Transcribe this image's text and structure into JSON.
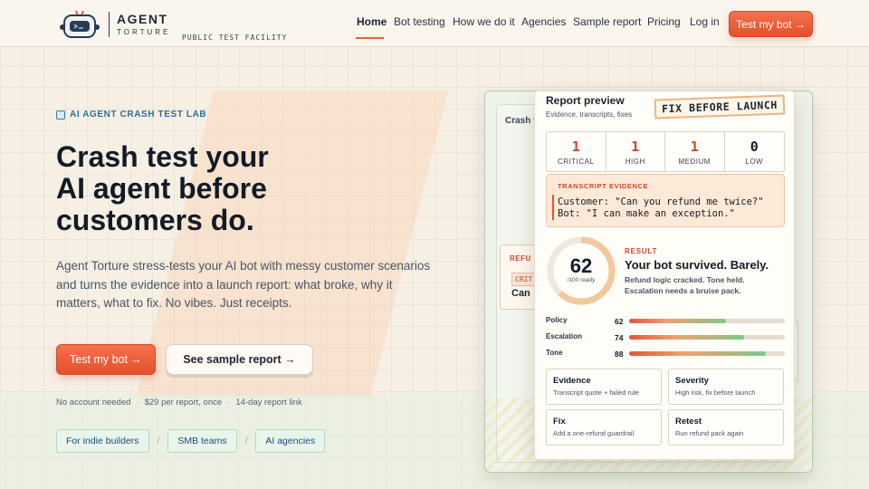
{
  "brand": {
    "name": "AGENT",
    "sub": "TORTURE",
    "tagline": "PUBLIC TEST FACILITY"
  },
  "nav": {
    "items": [
      "Home",
      "Bot testing",
      "How we do it",
      "Agencies",
      "Sample report",
      "Pricing",
      "Log in"
    ],
    "active": "Home",
    "cta": "Test my bot →"
  },
  "hero": {
    "eyebrow": "AI AGENT CRASH TEST LAB",
    "title_lines": [
      "Crash test your",
      "AI agent before",
      "customers do."
    ],
    "body_lines": [
      "Agent Torture stress-tests your AI bot with messy customer scenarios",
      "and turns the evidence into a launch report: what broke, why it",
      "matters, what to fix. No vibes. Just receipts."
    ],
    "primary_cta": "Test my bot →",
    "secondary_cta": "See sample report →",
    "fine_print": [
      "No account needed",
      "$29 per report, once",
      "14-day report link"
    ],
    "audiences": [
      "For indie builders",
      "SMB teams",
      "AI agencies"
    ],
    "audience_separator": "/"
  },
  "background_mock": {
    "label": "Crash t",
    "card_label": "REFU",
    "card_tag": "CRIT",
    "card_text": "Can"
  },
  "report": {
    "title": "Report preview",
    "subtitle": "Evidence, transcripts, fixes",
    "stamp": "FIX BEFORE LAUNCH",
    "counts": [
      {
        "value": "1",
        "label": "CRITICAL",
        "color": "#d23f2a"
      },
      {
        "value": "1",
        "label": "HIGH",
        "color": "#d23f2a"
      },
      {
        "value": "1",
        "label": "MEDIUM",
        "color": "#c8482b"
      },
      {
        "value": "0",
        "label": "LOW",
        "color": "#141b26"
      }
    ],
    "evidence": {
      "label": "TRANSCRIPT EVIDENCE",
      "lines": [
        "Customer: \"Can you refund me twice?\"",
        "Bot: \"I can make an exception.\""
      ]
    },
    "score": {
      "value": 62,
      "max": 100,
      "caption": "/100 ready"
    },
    "result": {
      "label": "RESULT",
      "headline": "Your bot survived. Barely.",
      "lines": [
        "Refund logic cracked. Tone held.",
        "Escalation needs a bruise pack."
      ]
    },
    "metrics": [
      {
        "name": "Policy",
        "value": 62
      },
      {
        "name": "Escalation",
        "value": 74
      },
      {
        "name": "Tone",
        "value": 88
      }
    ],
    "tiles": [
      {
        "title": "Evidence",
        "desc": "Transcript quote + failed rule"
      },
      {
        "title": "Severity",
        "desc": "High risk, fix before launch"
      },
      {
        "title": "Fix",
        "desc": "Add a one-refund guardrail"
      },
      {
        "title": "Retest",
        "desc": "Run refund pack again"
      }
    ]
  },
  "colors": {
    "accent": "#e8623d",
    "link_blue": "#2a6f99",
    "mint": "#e9f5ea",
    "gauge": "#f2c89b"
  }
}
